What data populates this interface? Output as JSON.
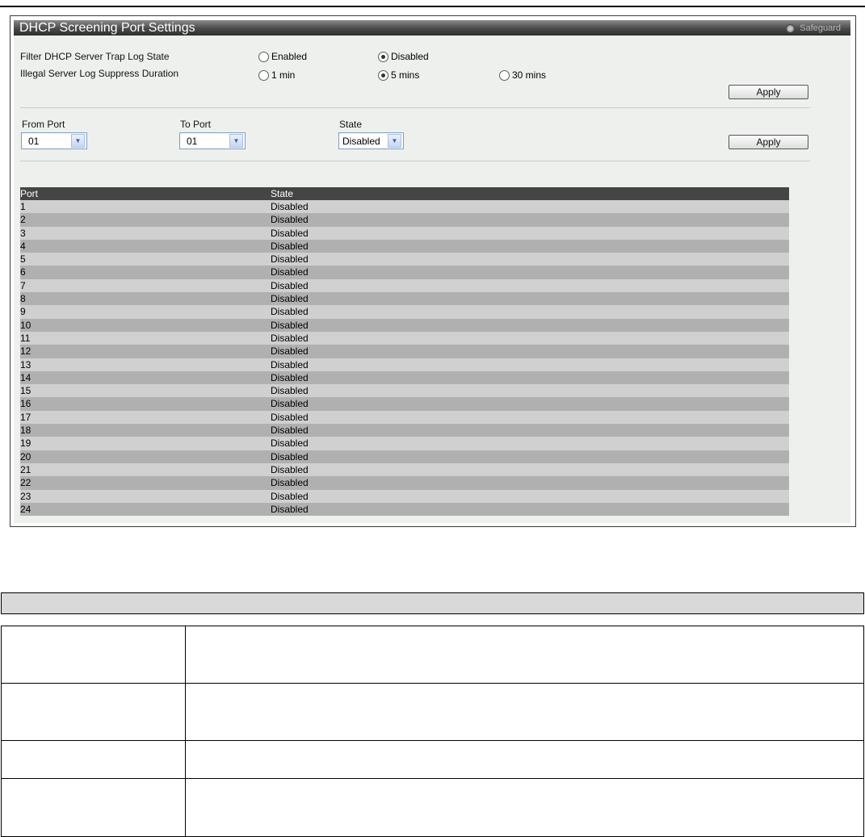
{
  "window": {
    "title": "DHCP Screening Port Settings",
    "safeguard_label": "Safeguard"
  },
  "trap_log": {
    "label": "Filter DHCP Server Trap Log State",
    "options": [
      {
        "label": "Enabled",
        "selected": false
      },
      {
        "label": "Disabled",
        "selected": true
      }
    ]
  },
  "suppress": {
    "label": "Illegal Server Log Suppress Duration",
    "options": [
      {
        "label": "1 min",
        "selected": false
      },
      {
        "label": "5 mins",
        "selected": true
      },
      {
        "label": "30 mins",
        "selected": false
      }
    ]
  },
  "apply_label": "Apply",
  "port_form": {
    "from_label": "From Port",
    "from_value": "01",
    "to_label": "To Port",
    "to_value": "01",
    "state_label": "State",
    "state_value": "Disabled"
  },
  "table": {
    "headers": {
      "port": "Port",
      "state": "State"
    },
    "rows": [
      {
        "port": "1",
        "state": "Disabled"
      },
      {
        "port": "2",
        "state": "Disabled"
      },
      {
        "port": "3",
        "state": "Disabled"
      },
      {
        "port": "4",
        "state": "Disabled"
      },
      {
        "port": "5",
        "state": "Disabled"
      },
      {
        "port": "6",
        "state": "Disabled"
      },
      {
        "port": "7",
        "state": "Disabled"
      },
      {
        "port": "8",
        "state": "Disabled"
      },
      {
        "port": "9",
        "state": "Disabled"
      },
      {
        "port": "10",
        "state": "Disabled"
      },
      {
        "port": "11",
        "state": "Disabled"
      },
      {
        "port": "12",
        "state": "Disabled"
      },
      {
        "port": "13",
        "state": "Disabled"
      },
      {
        "port": "14",
        "state": "Disabled"
      },
      {
        "port": "15",
        "state": "Disabled"
      },
      {
        "port": "16",
        "state": "Disabled"
      },
      {
        "port": "17",
        "state": "Disabled"
      },
      {
        "port": "18",
        "state": "Disabled"
      },
      {
        "port": "19",
        "state": "Disabled"
      },
      {
        "port": "20",
        "state": "Disabled"
      },
      {
        "port": "21",
        "state": "Disabled"
      },
      {
        "port": "22",
        "state": "Disabled"
      },
      {
        "port": "23",
        "state": "Disabled"
      },
      {
        "port": "24",
        "state": "Disabled"
      }
    ]
  },
  "colors": {
    "title_bar": "#3a3a3a",
    "panel_bg": "#eef0ee",
    "table_header": "#454545",
    "row_light": "#d0d0d0",
    "row_dark": "#b0b0b0"
  },
  "icons": {
    "select_arrow": "chevron-down-icon",
    "status": "safeguard-indicator-icon"
  }
}
